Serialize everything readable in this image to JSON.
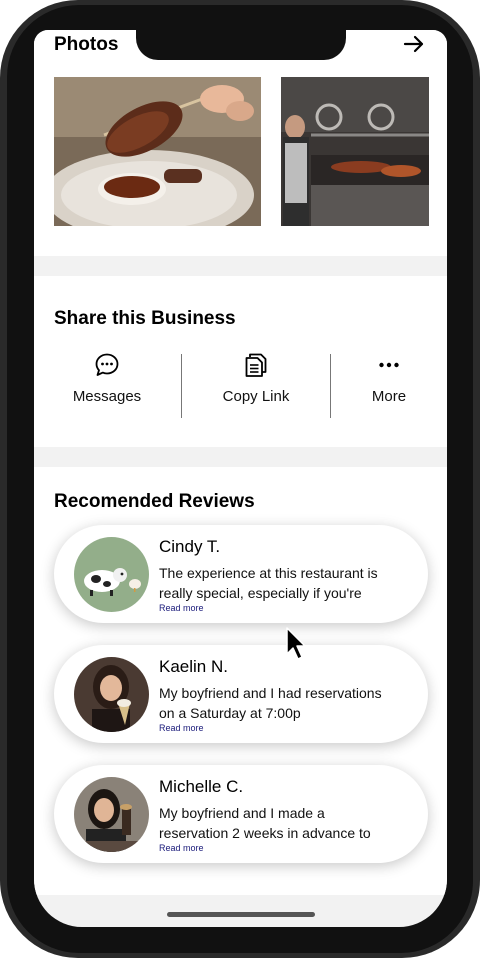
{
  "photos": {
    "title": "Photos"
  },
  "share": {
    "title": "Share this Business",
    "options": [
      {
        "label": "Messages",
        "icon": "message-bubble-icon"
      },
      {
        "label": "Copy Link",
        "icon": "document-copy-icon"
      },
      {
        "label": "More",
        "icon": "more-dots-icon"
      }
    ]
  },
  "reviews": {
    "title": "Recomended Reviews",
    "items": [
      {
        "name": "Cindy T.",
        "text": "The experience at this restaurant is really special, especially if you're",
        "read_more": "Read more"
      },
      {
        "name": "Kaelin N.",
        "text": "My boyfriend and I had reservations on a Saturday at 7:00p",
        "read_more": "Read more"
      },
      {
        "name": "Michelle C.",
        "text": "My boyfriend and I made a reservation 2 weeks in advance to",
        "read_more": "Read more"
      }
    ]
  },
  "colors": {
    "background": "#f2f2f2",
    "card": "#ffffff",
    "read_more": "#1a1a7a",
    "frame": "#111111"
  }
}
